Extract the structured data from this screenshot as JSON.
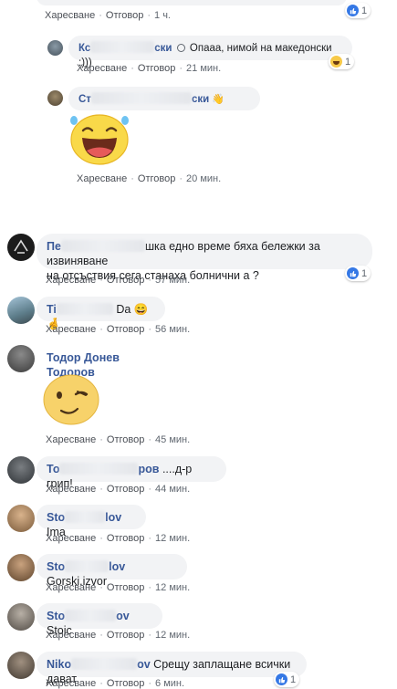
{
  "common": {
    "like": "Харесване",
    "reply": "Отговор",
    "dot": "·"
  },
  "top_comment": {
    "time": "1 ч.",
    "like_count": "1"
  },
  "reply1": {
    "name_start": "Кс",
    "name_end": "ски",
    "text": "Опааа, нимой на македонски :)))",
    "time": "21 мин.",
    "react_count": "1"
  },
  "reply2": {
    "name_start": "Ст",
    "name_end": "ски",
    "time": "20 мин."
  },
  "c1": {
    "name_start": "Пе",
    "text_line1": "шка едно време бяха бележки за извиняване",
    "text_line2": "на отсъствия сега станаха болнични а ?",
    "time": "57 мин.",
    "like_count": "1"
  },
  "c2": {
    "name_start": "Ti",
    "text": "Da 😄🤞",
    "time": "56 мин."
  },
  "c3": {
    "name": "Тодор Донев Тодоров",
    "time": "45 мин."
  },
  "c4": {
    "name_start": "То",
    "name_end": "ров",
    "text": "....д-р грип!",
    "time": "44 мин."
  },
  "c5": {
    "name_start": "Sto",
    "name_end": "lov",
    "text": "Ima",
    "time": "12 мин."
  },
  "c6": {
    "name_start": "Sto",
    "name_end": "lov",
    "text": "Gorski.izvor",
    "time": "12 мин."
  },
  "c7": {
    "name_start": "Sto",
    "name_end": "ov",
    "text": "Stoic",
    "time": "12 мин."
  },
  "c8": {
    "name_start": "Niko",
    "name_end": "ov",
    "text": "Срещу заплащане всички дават",
    "time": "6 мин.",
    "like_count": "1"
  },
  "colors": {
    "link": "#385898",
    "bubble": "#f2f3f5",
    "like_blue": "#3578e5"
  }
}
